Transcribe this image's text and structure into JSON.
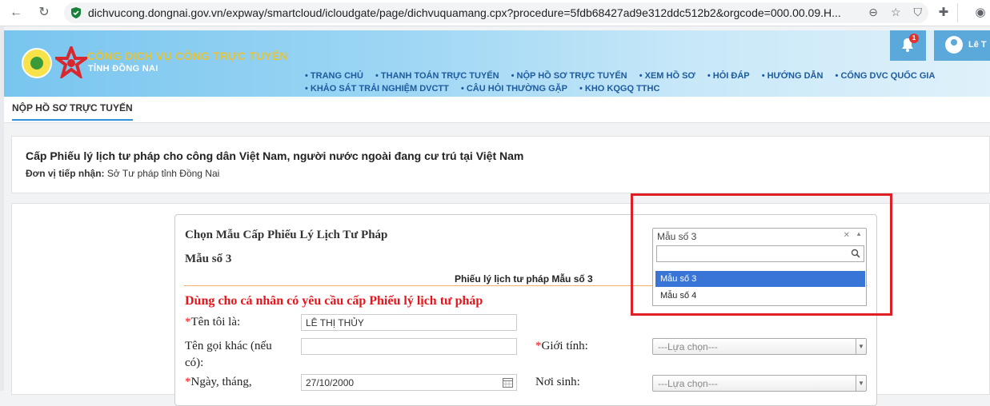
{
  "browser": {
    "url": "dichvucong.dongnai.gov.vn/expway/smartcloud/icloudgate/page/dichvuquamang.cpx?procedure=5fdb68427ad9e312ddc512b2&orgcode=000.00.09.H..."
  },
  "header": {
    "title": "CỔNG DỊCH VỤ CÔNG TRỰC TUYẾN",
    "subtitle": "TỈNH ĐỒNG NAI",
    "menu_row1": [
      "TRANG CHỦ",
      "THANH TOÁN TRỰC TUYẾN",
      "NỘP HỒ SƠ TRỰC TUYẾN",
      "XEM HỒ SƠ",
      "HỎI ĐÁP",
      "HƯỚNG DẪN",
      "CỔNG DVC QUỐC GIA"
    ],
    "menu_row2": [
      "KHẢO SÁT TRẢI NGHIỆM DVCTT",
      "CÂU HỎI THƯỜNG GẶP",
      "KHO KQGQ TTHC"
    ],
    "notification_count": "1",
    "user_name": "Lê T"
  },
  "tab": {
    "label": "NỘP HỒ SƠ TRỰC TUYẾN"
  },
  "procedure": {
    "title": "Cấp Phiếu lý lịch tư pháp cho công dân Việt Nam, người nước ngoài đang cư trú tại Việt Nam",
    "unit_label": "Đơn vị tiếp nhận:",
    "unit_value": "Sở Tư pháp tỉnh Đồng Nai"
  },
  "form": {
    "choose_title": "Chọn Mẫu Cấp Phiếu Lý Lịch Tư Pháp",
    "selected_form_heading": "Mẫu số 3",
    "caption": "Phiếu lý lịch tư pháp Mẫu số 3",
    "red_title": "Dùng cho cá nhân có yêu cầu cấp Phiếu lý lịch tư pháp",
    "name_label": "Tên tôi là:",
    "name_value": "LÊ THỊ THỦY",
    "alias_label_1": "Tên gọi khác (nếu",
    "alias_label_2": "có):",
    "alias_value": "",
    "gender_label": "Giới tính:",
    "gender_value": "---Lựa chọn---",
    "dob_label": "Ngày, tháng,",
    "dob_value": "27/10/2000",
    "pob_label": "Nơi sinh:",
    "pob_value": "---Lựa chọn---"
  },
  "mau_select": {
    "selected": "Mẫu số 3",
    "search_value": "",
    "options": [
      "Mẫu số 3",
      "Mẫu số 4"
    ]
  },
  "colors": {
    "highlight_frame": "#e01e25",
    "option_active": "#3875d7",
    "menu_text": "#1d5a9f",
    "title_gold": "#e5c33b",
    "required_red": "#e8141b"
  }
}
